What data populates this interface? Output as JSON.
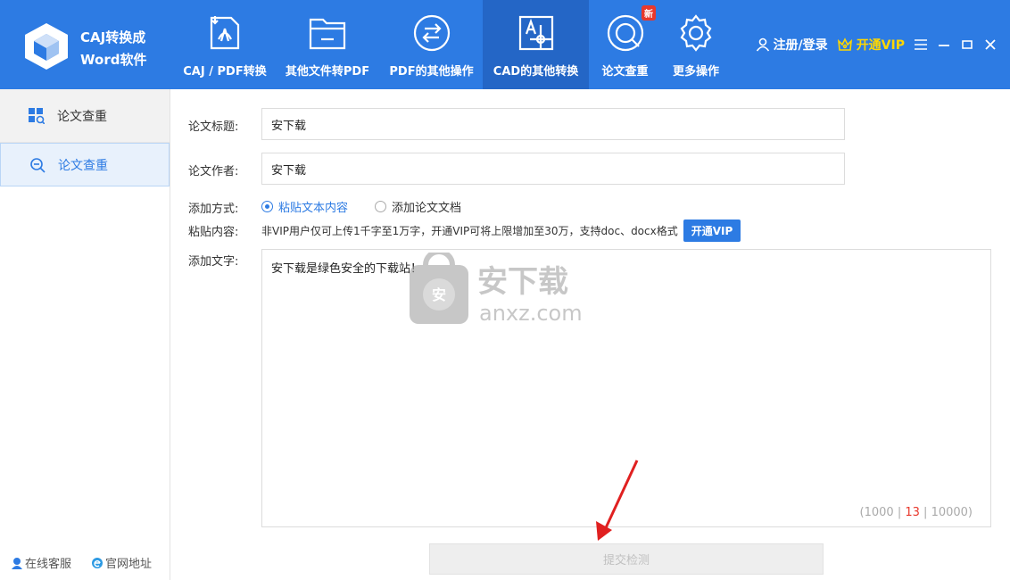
{
  "app": {
    "brand_line1": "CAJ转换成",
    "brand_line2": "Word软件"
  },
  "nav": [
    {
      "label": "CAJ / PDF转换",
      "icon": "pdf-convert-icon"
    },
    {
      "label": "其他文件转PDF",
      "icon": "folder-icon"
    },
    {
      "label": "PDF的其他操作",
      "icon": "swap-arrows-icon"
    },
    {
      "label": "CAD的其他转换",
      "icon": "cad-icon",
      "active": true
    },
    {
      "label": "论文查重",
      "icon": "plagiarism-check-icon",
      "badge": "新"
    },
    {
      "label": "更多操作",
      "icon": "gear-icon"
    }
  ],
  "top_right": {
    "login": "注册/登录",
    "vip": "开通VIP"
  },
  "sidebar": {
    "header": "论文查重",
    "item": "论文查重",
    "footer_service": "在线客服",
    "footer_site": "官网地址"
  },
  "form": {
    "title_label": "论文标题:",
    "title_value": "安下载",
    "author_label": "论文作者:",
    "author_value": "安下载",
    "method_label": "添加方式:",
    "option_paste": "粘贴文本内容",
    "option_doc": "添加论文文档",
    "paste_label": "粘贴内容:",
    "notice": "非VIP用户仅可上传1千字至1万字，开通VIP可将上限增加至30万，支持doc、docx格式",
    "vip_button": "开通VIP",
    "text_label": "添加文字:",
    "text_value": "安下载是绿色安全的下载站！",
    "counter_min": "1000",
    "counter_current": "13",
    "counter_max": "10000",
    "submit": "提交检测"
  },
  "watermark": {
    "brand": "安下载",
    "domain": "anxz.com"
  },
  "colors": {
    "primary": "#2d7be3",
    "active_nav": "#2466c6",
    "badge": "#e8382c",
    "vip": "#ffd700"
  }
}
